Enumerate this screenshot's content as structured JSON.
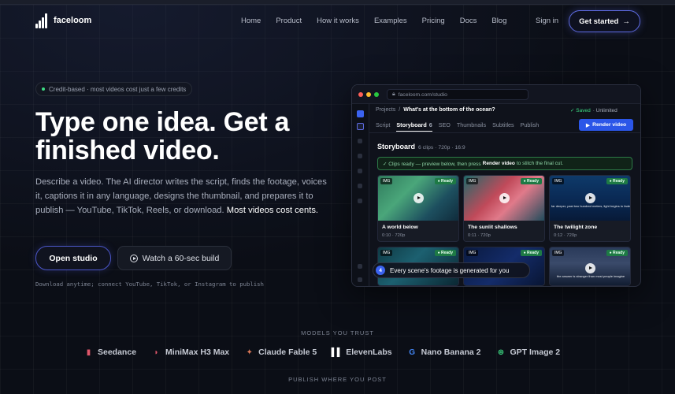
{
  "brand": {
    "name": "faceloom"
  },
  "nav": {
    "links": [
      "Home",
      "Product",
      "How it works",
      "Examples",
      "Pricing",
      "Docs",
      "Blog"
    ],
    "signin": "Sign in",
    "cta": "Get started",
    "cta_arrow": "→"
  },
  "hero": {
    "pill": "Credit-based · most videos cost just a few credits",
    "headline": "Type one idea. Get a finished video.",
    "description": "Describe a video. The AI director writes the script, finds the footage, voices it, captions it in any language, designs the thumbnail, and prepares it to publish — YouTube, TikTok, Reels, or download.",
    "description_highlight": "Most videos cost cents.",
    "btn_primary": "Open studio",
    "btn_secondary": "Watch a 60-sec build",
    "note": "Download anytime; connect YouTube, TikTok, or Instagram to publish"
  },
  "app": {
    "url": "faceloom.com/studio",
    "crumb_parent": "Projects",
    "crumb_sep": "/",
    "project_title": "What's at the bottom of the ocean?",
    "saved": "✓ Saved",
    "saved_extra": "· Unlimited",
    "tabs": [
      "Script",
      "Storyboard",
      "SEO",
      "Thumbnails",
      "Subtitles",
      "Publish"
    ],
    "storyboard_count": "6",
    "render_label": "Render video",
    "storyboard_title": "Storyboard",
    "storyboard_meta": "6 clips · 720p · 16:9",
    "banner_pre": "✓ Clips ready — preview below, then press",
    "banner_bold": "Render video",
    "banner_post": "to stitch the final cut.",
    "img_tag": "IMG",
    "ready_label": "● Ready",
    "clips": [
      {
        "name": "A world below",
        "meta": "0:10 · 720p",
        "caption": "",
        "bg": "linear-gradient(135deg,#2f7a5c 0%,#4aa67a 35%,#1d4f5f 70%,#0f2a3a 100%)"
      },
      {
        "name": "The sunlit shallows",
        "meta": "0:11 · 720p",
        "caption": "",
        "bg": "linear-gradient(135deg,#1f6a6a 0%,#c04a5a 40%,#e07a8a 60%,#1a4a5a 100%)"
      },
      {
        "name": "The twilight zone",
        "meta": "0:12 · 720p",
        "caption": "far deeper, past two hundred meters, light begins to fade",
        "bg": "linear-gradient(180deg,#0e3a6a 0%,#0a2a55 50%,#071a38 100%)"
      },
      {
        "name": "",
        "meta": "",
        "caption": "",
        "bg": "linear-gradient(135deg,#0f3a44 0%,#1c6070 40%,#0a2530 100%)"
      },
      {
        "name": "",
        "meta": "",
        "caption": "",
        "bg": "linear-gradient(135deg,#0a1a40 0%,#142c6a 50%,#081430 100%)"
      },
      {
        "name": "",
        "meta": "",
        "caption": "the answer is stranger than most people imagine",
        "bg": "linear-gradient(180deg,#2a3a5a 0%,#3a4a6a 40%,#0f1a2e 100%)"
      }
    ],
    "toast_num": "4",
    "toast": "Every scene's footage is generated for you"
  },
  "models": {
    "label": "MODELS YOU TRUST",
    "items": [
      {
        "name": "Seedance",
        "icon": "seedance-icon",
        "glyph": "▮",
        "color": "#e0566a"
      },
      {
        "name": "MiniMax H3 Max",
        "icon": "minimax-icon",
        "glyph": "◗",
        "color": "#e0566a"
      },
      {
        "name": "Claude Fable 5",
        "icon": "claude-icon",
        "glyph": "✦",
        "color": "#d97757"
      },
      {
        "name": "ElevenLabs",
        "icon": "elevenlabs-icon",
        "glyph": "▌▌",
        "color": "#ffffff"
      },
      {
        "name": "Nano Banana 2",
        "icon": "google-icon",
        "glyph": "G",
        "color": "#4285f4"
      },
      {
        "name": "GPT Image 2",
        "icon": "openai-icon",
        "glyph": "⊛",
        "color": "#3ddc84"
      }
    ],
    "publish_label": "PUBLISH WHERE YOU POST"
  }
}
